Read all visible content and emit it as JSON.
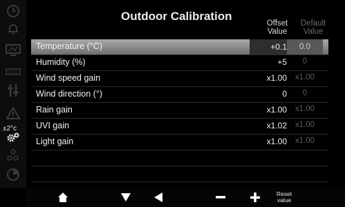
{
  "title": "Outdoor Calibration",
  "columns": {
    "offset_line1": "Offset",
    "offset_line2": "Value",
    "default_line1": "Default",
    "default_line2": "Value"
  },
  "rows": [
    {
      "label": "Temperature (°C)",
      "offset": "+0.1",
      "default": "0.0"
    },
    {
      "label": "Humidity (%)",
      "offset": "+5",
      "default": "0"
    },
    {
      "label": "Wind speed gain",
      "offset": "x1.00",
      "default": "x1.00"
    },
    {
      "label": "Wind direction (°)",
      "offset": "0",
      "default": "0"
    },
    {
      "label": "Rain gain",
      "offset": "x1.00",
      "default": "x1.00"
    },
    {
      "label": "UVI gain",
      "offset": "x1.02",
      "default": "x1.00"
    },
    {
      "label": "Light gain",
      "offset": "x1.00",
      "default": "x1.00"
    }
  ],
  "sidebar": {
    "icons": [
      "clock-icon",
      "bell-icon",
      "display-icon",
      "keyboard-icon",
      "sensors-icon",
      "alert-icon",
      "calibration-icon",
      "share-icon",
      "chart-icon"
    ],
    "calibration_label": "±2°c"
  },
  "bottombar": {
    "icons": [
      "home-icon",
      "down-arrow-icon",
      "left-arrow-icon",
      "minus-icon",
      "plus-icon"
    ],
    "reset_line1": "Reset",
    "reset_line2": "value"
  },
  "colors": {
    "background": "#000000",
    "highlight": "#8c8c8c",
    "text": "#f2f2f2",
    "dim_text": "#5d5d5d"
  }
}
